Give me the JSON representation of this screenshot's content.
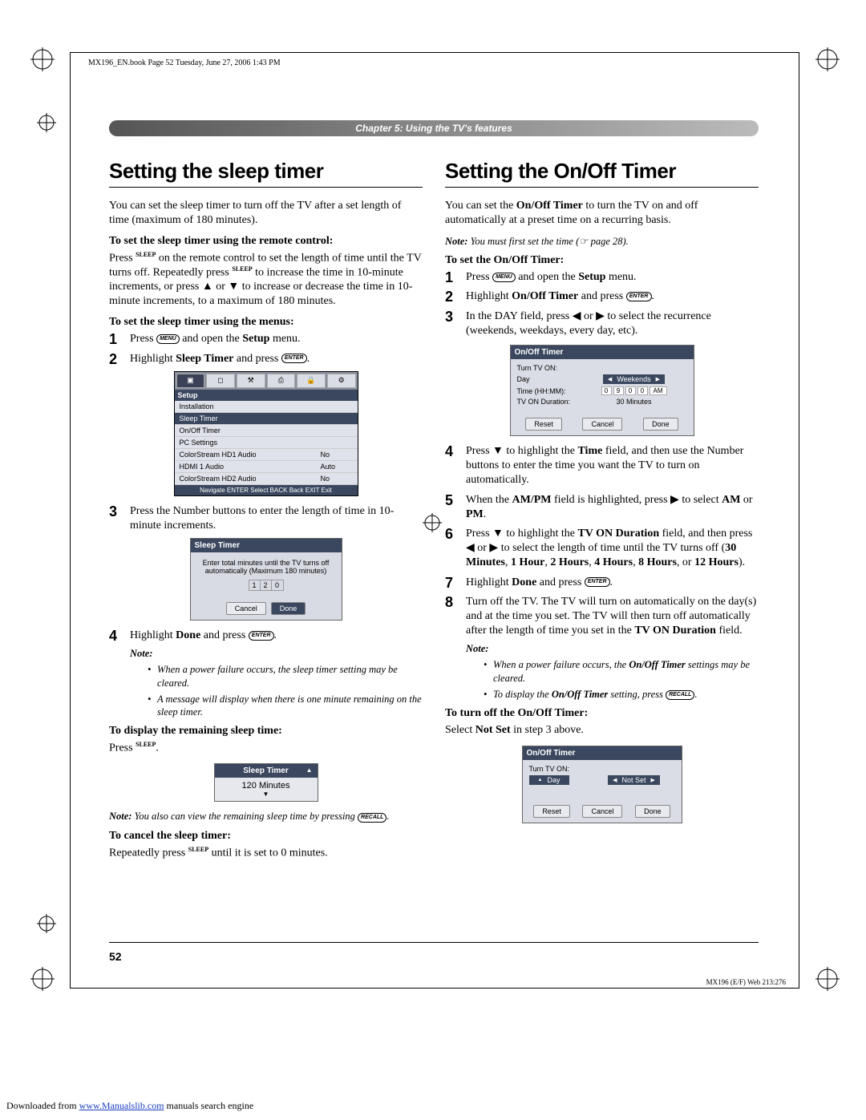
{
  "meta": {
    "header": "MX196_EN.book  Page 52  Tuesday, June 27, 2006  1:43 PM",
    "chapter": "Chapter 5: Using the TV's features",
    "page_number": "52",
    "footer_code": "MX196 (E/F) Web 213:276",
    "download_prefix": "Downloaded from ",
    "download_link": "www.Manualslib.com",
    "download_suffix": " manuals search engine"
  },
  "icons": {
    "menu": "MENU",
    "enter": "ENTER",
    "recall": "RECALL",
    "sleep": "SLEEP"
  },
  "left": {
    "title": "Setting the sleep timer",
    "intro": "You can set the sleep timer to turn off the TV after a set length of time (maximum of 180 minutes).",
    "sub1": "To set the sleep timer using the remote control:",
    "p1a": "Press ",
    "p1b": " on the remote control to set the length of time until the TV turns off. Repeatedly press ",
    "p1c": " to increase the time in 10-minute increments, or press ▲ or ▼ to increase or decrease the time in 10-minute increments, to a maximum of 180 minutes.",
    "sub2": "To set the sleep timer using the menus:",
    "step1a": "Press ",
    "step1b": " and open the ",
    "step1c": "Setup",
    "step1d": " menu.",
    "step2a": "Highlight ",
    "step2b": "Sleep Timer",
    "step2c": " and press ",
    "step3": "Press the Number buttons to enter the length of time in 10-minute increments.",
    "step4a": "Highlight ",
    "step4b": "Done",
    "step4c": " and press ",
    "note_label": "Note:",
    "note1": "When a power failure occurs, the sleep timer setting may be cleared.",
    "note2": "A message will display when there is one minute remaining on the sleep timer.",
    "sub3": "To display the remaining sleep time:",
    "p3a": "Press ",
    "p3note_pre": "Note:",
    "p3note": " You also can view the remaining sleep time by pressing ",
    "sub4": "To cancel the sleep timer:",
    "p4a": "Repeatedly press ",
    "p4b": " until it is set to 0 minutes.",
    "osd": {
      "section": "Setup",
      "items": [
        {
          "k": "Installation",
          "v": ""
        },
        {
          "k": "Sleep Timer",
          "v": "",
          "hl": true
        },
        {
          "k": "On/Off Timer",
          "v": ""
        },
        {
          "k": "PC Settings",
          "v": ""
        },
        {
          "k": "ColorStream HD1 Audio",
          "v": "No"
        },
        {
          "k": "HDMI 1 Audio",
          "v": "Auto"
        },
        {
          "k": "ColorStream HD2 Audio",
          "v": "No"
        }
      ],
      "footer": "Navigate  ENTER Select  BACK Back  EXIT Exit"
    },
    "dialog": {
      "title": "Sleep Timer",
      "body": "Enter total minutes until the TV turns off automatically (Maximum 180 minutes)",
      "digits": [
        "1",
        "2",
        "0"
      ],
      "cancel": "Cancel",
      "done": "Done"
    },
    "popup": {
      "title": "Sleep Timer",
      "value": "120 Minutes"
    }
  },
  "right": {
    "title": "Setting the On/Off Timer",
    "intro_a": "You can set the ",
    "intro_b": "On/Off Timer",
    "intro_c": " to turn the TV on and off automatically at a preset time on a recurring basis.",
    "note_pre": "Note:",
    "note_text": " You must first set the time (☞ page 28).",
    "sub1": "To set the On/Off Timer:",
    "s1a": "Press ",
    "s1b": " and open the ",
    "s1c": "Setup",
    "s1d": " menu.",
    "s2a": "Highlight ",
    "s2b": "On/Off Timer",
    "s2c": " and press ",
    "s3": "In the DAY field, press ◀ or ▶ to select the recurrence (weekends, weekdays, every day, etc).",
    "s4a": "Press ▼ to highlight the ",
    "s4b": "Time",
    "s4c": " field, and then use the Number buttons to enter the time you want the TV to turn on automatically.",
    "s5a": "When the ",
    "s5b": "AM/PM",
    "s5c": " field is highlighted, press ▶ to select ",
    "s5d": "AM",
    "s5e": " or ",
    "s5f": "PM",
    "s6a": "Press ▼ to highlight the ",
    "s6b": "TV ON Duration",
    "s6c": " field, and then press ◀ or ▶ to select the length of time until the TV turns off (",
    "s6d": "30 Minutes",
    "s6e": "1 Hour",
    "s6f": "2 Hours",
    "s6g": "4 Hours",
    "s6h": "8 Hours",
    "s6i": "12 Hours",
    "s7a": "Highlight ",
    "s7b": "Done",
    "s7c": " and press ",
    "s8a": "Turn off the TV. The TV will turn on automatically on the day(s) and at the time you set. The TV will then turn off automatically after the length of time you set in the ",
    "s8b": "TV ON Duration",
    "s8c": " field.",
    "note2_label": "Note:",
    "note2_1a": "When a power failure occurs, the ",
    "note2_1b": "On/Off Timer",
    "note2_1c": " settings may be cleared.",
    "note2_2a": "To display the ",
    "note2_2b": "On/Off Timer",
    "note2_2c": " setting, press ",
    "sub2": "To turn off the On/Off Timer:",
    "p2a": "Select ",
    "p2b": "Not Set",
    "p2c": " in step 3 above.",
    "dialog1": {
      "title": "On/Off Timer",
      "section": "Turn TV ON:",
      "day_label": "Day",
      "day_value": "Weekends",
      "time_label": "Time (HH:MM):",
      "time_digits": [
        "0",
        "9",
        "0",
        "0"
      ],
      "ampm": "AM",
      "duration_label": "TV ON Duration:",
      "duration_value": "30 Minutes",
      "reset": "Reset",
      "cancel": "Cancel",
      "done": "Done"
    },
    "dialog2": {
      "title": "On/Off Timer",
      "section": "Turn TV ON:",
      "day_label": "Day",
      "day_value": "Not Set",
      "reset": "Reset",
      "cancel": "Cancel",
      "done": "Done"
    }
  }
}
